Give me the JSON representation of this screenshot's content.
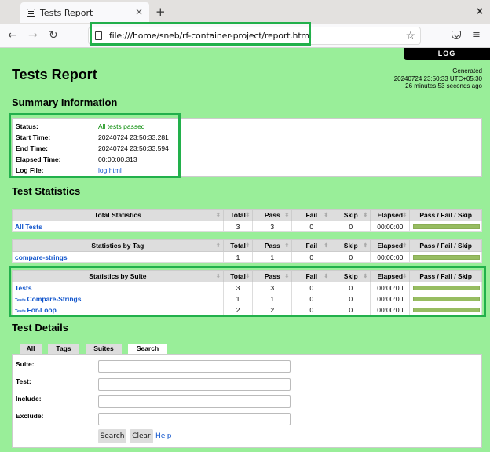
{
  "browser": {
    "tab_title": "Tests Report",
    "url": "file:///home/sneb/rf-container-project/report.html"
  },
  "page": {
    "log_button": "LOG",
    "title": "Tests Report",
    "generated": {
      "label": "Generated",
      "timestamp": "20240724 23:50:33 UTC+05:30",
      "ago": "26 minutes 53 seconds ago"
    }
  },
  "summary": {
    "heading": "Summary Information",
    "rows": [
      {
        "label": "Status:",
        "value": "All tests passed"
      },
      {
        "label": "Start Time:",
        "value": "20240724 23:50:33.281"
      },
      {
        "label": "End Time:",
        "value": "20240724 23:50:33.594"
      },
      {
        "label": "Elapsed Time:",
        "value": "00:00:00.313"
      },
      {
        "label": "Log File:",
        "value": "log.html"
      }
    ]
  },
  "statistics": {
    "heading": "Test Statistics",
    "columns": [
      "Total",
      "Pass",
      "Fail",
      "Skip",
      "Elapsed",
      "Pass / Fail / Skip"
    ],
    "tables": [
      {
        "title": "Total Statistics",
        "rows": [
          {
            "parent": "",
            "name": "All Tests",
            "total": "3",
            "pass": "3",
            "fail": "0",
            "skip": "0",
            "elapsed": "00:00:00",
            "pass_ratio": 1.0
          }
        ]
      },
      {
        "title": "Statistics by Tag",
        "rows": [
          {
            "parent": "",
            "name": "compare-strings",
            "total": "1",
            "pass": "1",
            "fail": "0",
            "skip": "0",
            "elapsed": "00:00:00",
            "pass_ratio": 1.0
          }
        ]
      },
      {
        "title": "Statistics by Suite",
        "rows": [
          {
            "parent": "",
            "name": "Tests",
            "total": "3",
            "pass": "3",
            "fail": "0",
            "skip": "0",
            "elapsed": "00:00:00",
            "pass_ratio": 1.0
          },
          {
            "parent": "Tests . ",
            "name": "Compare-Strings",
            "total": "1",
            "pass": "1",
            "fail": "0",
            "skip": "0",
            "elapsed": "00:00:00",
            "pass_ratio": 1.0
          },
          {
            "parent": "Tests . ",
            "name": "For-Loop",
            "total": "2",
            "pass": "2",
            "fail": "0",
            "skip": "0",
            "elapsed": "00:00:00",
            "pass_ratio": 1.0
          }
        ]
      }
    ]
  },
  "details": {
    "heading": "Test Details",
    "tabs": [
      "All",
      "Tags",
      "Suites",
      "Search"
    ],
    "active_tab": "Search",
    "fields": [
      {
        "label": "Suite:",
        "value": ""
      },
      {
        "label": "Test:",
        "value": ""
      },
      {
        "label": "Include:",
        "value": ""
      },
      {
        "label": "Exclude:",
        "value": ""
      }
    ],
    "search_button": "Search",
    "clear_button": "Clear",
    "help_link": "Help"
  },
  "colors": {
    "page_background": "#99ee99",
    "pass_bar": "#97bd61",
    "highlight_box": "#22b04b",
    "link": "#1155cc"
  }
}
